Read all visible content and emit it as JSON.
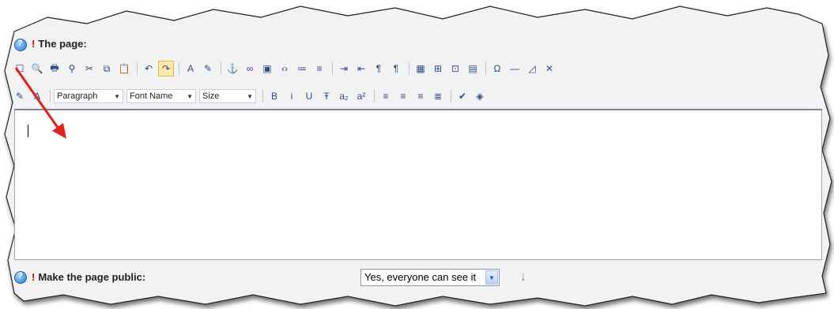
{
  "page_field": {
    "label": "The page:",
    "required_mark": "!"
  },
  "toolbar1": [
    {
      "name": "new-doc-icon",
      "glyph": "☐"
    },
    {
      "name": "preview-icon",
      "glyph": "🔍"
    },
    {
      "name": "print-icon",
      "glyph": "🖶"
    },
    {
      "name": "find-icon",
      "glyph": "⚲"
    },
    {
      "name": "cut-icon",
      "glyph": "✂"
    },
    {
      "name": "copy-icon",
      "glyph": "⧉"
    },
    {
      "name": "paste-icon",
      "glyph": "📋"
    },
    {
      "sep": true
    },
    {
      "name": "undo-icon",
      "glyph": "↶"
    },
    {
      "name": "redo-icon",
      "glyph": "↷",
      "active": true
    },
    {
      "sep": true
    },
    {
      "name": "text-color-icon",
      "glyph": "A"
    },
    {
      "name": "highlight-icon",
      "glyph": "✎"
    },
    {
      "sep": true
    },
    {
      "name": "anchor-icon",
      "glyph": "⚓"
    },
    {
      "name": "link-icon",
      "glyph": "∞"
    },
    {
      "name": "image-icon",
      "glyph": "▣"
    },
    {
      "name": "source-icon",
      "glyph": "‹›"
    },
    {
      "name": "ordered-list-icon",
      "glyph": "≔"
    },
    {
      "name": "unordered-list-icon",
      "glyph": "≡"
    },
    {
      "sep": true
    },
    {
      "name": "indent-icon",
      "glyph": "⇥"
    },
    {
      "name": "outdent-icon",
      "glyph": "⇤"
    },
    {
      "name": "ltr-icon",
      "glyph": "¶"
    },
    {
      "name": "rtl-icon",
      "glyph": "¶"
    },
    {
      "sep": true
    },
    {
      "name": "table-icon",
      "glyph": "▦"
    },
    {
      "name": "table-edit-icon",
      "glyph": "⊞"
    },
    {
      "name": "grid-icon",
      "glyph": "⊡"
    },
    {
      "name": "layer-icon",
      "glyph": "▤"
    },
    {
      "sep": true
    },
    {
      "name": "special-char-icon",
      "glyph": "Ω"
    },
    {
      "name": "horizontal-rule-icon",
      "glyph": "—"
    },
    {
      "name": "eraser-icon",
      "glyph": "◿"
    },
    {
      "name": "delete-icon",
      "glyph": "✕"
    }
  ],
  "toolbar2_left": [
    {
      "name": "styles-icon",
      "glyph": "✎"
    },
    {
      "name": "font-style-icon",
      "glyph": "A"
    }
  ],
  "dropdowns": [
    {
      "name": "paragraph-select",
      "label": "Paragraph",
      "w": 88
    },
    {
      "name": "font-name-select",
      "label": "Font Name",
      "w": 88
    },
    {
      "name": "size-select",
      "label": "Size",
      "w": 72
    }
  ],
  "toolbar2_right": [
    {
      "name": "bold-icon",
      "glyph": "B"
    },
    {
      "name": "italic-icon",
      "glyph": "i"
    },
    {
      "name": "underline-icon",
      "glyph": "U"
    },
    {
      "name": "strikethrough-icon",
      "glyph": "Ŧ"
    },
    {
      "name": "subscript-icon",
      "glyph": "a₂"
    },
    {
      "name": "superscript-icon",
      "glyph": "a²"
    },
    {
      "sep": true
    },
    {
      "name": "align-left-icon",
      "glyph": "≡"
    },
    {
      "name": "align-center-icon",
      "glyph": "≡"
    },
    {
      "name": "align-right-icon",
      "glyph": "≡"
    },
    {
      "name": "justify-icon",
      "glyph": "≣"
    },
    {
      "sep": true
    },
    {
      "name": "spellcheck-icon",
      "glyph": "✔"
    },
    {
      "name": "plugin-icon",
      "glyph": "◈"
    }
  ],
  "public_field": {
    "label": "Make the page public:",
    "required_mark": "!",
    "selected": "Yes, everyone can see it"
  },
  "colors": {
    "arrow": "#e0201a",
    "required": "#d40000",
    "active_button": "#ffe7a8"
  }
}
